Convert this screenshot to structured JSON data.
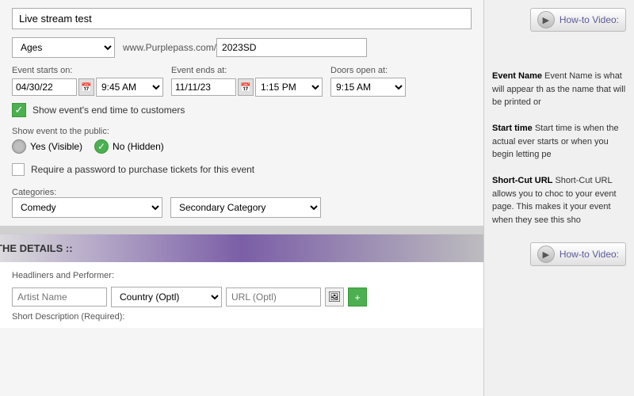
{
  "event": {
    "name": "Live stream test",
    "url_prefix": "www.Purplepass.com/",
    "url_value": "2023SD",
    "ages": "Ages",
    "starts_label": "Event starts on:",
    "starts_date": "04/30/22",
    "starts_time": "9:45 AM",
    "ends_label": "Event ends at:",
    "ends_date": "11/11/23",
    "ends_time": "1:15 PM",
    "doors_label": "Doors open at:",
    "doors_time": "9:15 AM",
    "show_end_time_label": "Show event's end time to customers",
    "visibility_label": "Show event to the public:",
    "yes_label": "Yes (Visible)",
    "no_label": "No (Hidden)",
    "password_label": "Require a password to purchase tickets for this event",
    "categories_label": "Categories:",
    "primary_category": "Comedy",
    "secondary_category": "Secondary Category"
  },
  "details": {
    "header": "THE DETAILS ::",
    "performer_label": "Headliners and Performer:",
    "artist_placeholder": "Artist Name",
    "country_placeholder": "Country (Optl)",
    "url_placeholder": "URL (Optl)",
    "short_desc_label": "Short Description (Required):"
  },
  "right_panel": {
    "how_to_video_label": "How-to Video:",
    "how_to_video_label2": "How-to Video:",
    "event_name_desc": "Event Name is what will appear th as the name that will be printed or",
    "start_time_desc": "Start time is when the actual ever starts or when you begin letting pe",
    "shortcut_desc": "Short-Cut URL allows you to choc to your event page. This makes it your event when they see this sho"
  }
}
